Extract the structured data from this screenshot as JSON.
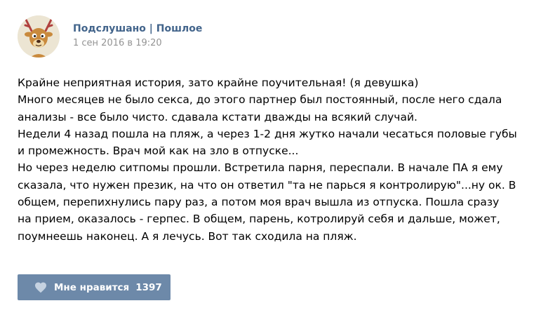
{
  "post": {
    "author": "Подслушано | Пошлое",
    "date": "1 сен 2016 в 19:20",
    "avatar_icon": "deer-avatar-icon",
    "lines": [
      "Крайне неприятная история, зато крайне поучительная! (я девушка)",
      "Много месяцев не было секса, до этого партнер был постоянный, после него сдала",
      "анализы - все было чисто. сдавала кстати дважды на всякий случай.",
      "Недели 4 назад пошла на пляж, а через 1-2 дня жутко начали чесаться половые губы",
      "и промежность. Врач мой как на зло в отпуске...",
      "Но через неделю ситпомы прошли. Встретила парня, переспали. В начале ПА я ему",
      "сказала, что нужен презик, на что он ответил \"та не парься я контролирую\"...ну ок. В",
      "общем, перепихнулись пару раз, а потом моя врач вышла из отпуска. Пошла сразу",
      "на прием, оказалось - герпес. В общем, парень, котролируй себя и дальше, может,",
      "поумнеешь наконец. А я лечусь. Вот так сходила на пляж."
    ],
    "like": {
      "label": "Мне нравится",
      "count": "1397",
      "icon": "heart-icon"
    }
  },
  "colors": {
    "author": "#42648b",
    "date": "#939393",
    "like_button": "#6d89a9"
  }
}
